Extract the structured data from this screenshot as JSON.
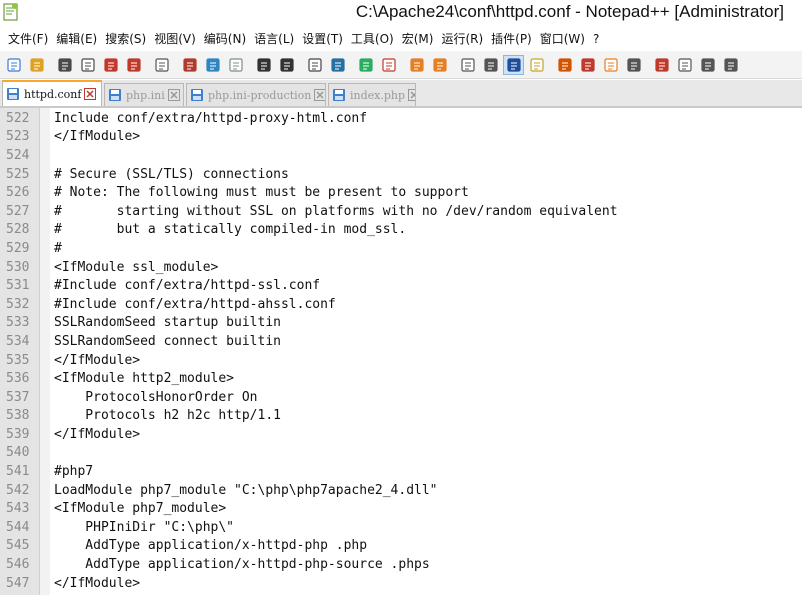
{
  "window": {
    "title": "C:\\Apache24\\conf\\httpd.conf - Notepad++ [Administrator]"
  },
  "menu": [
    {
      "label": "文件(F)"
    },
    {
      "label": "编辑(E)"
    },
    {
      "label": "搜索(S)"
    },
    {
      "label": "视图(V)"
    },
    {
      "label": "编码(N)"
    },
    {
      "label": "语言(L)"
    },
    {
      "label": "设置(T)"
    },
    {
      "label": "工具(O)"
    },
    {
      "label": "宏(M)"
    },
    {
      "label": "运行(R)"
    },
    {
      "label": "插件(P)"
    },
    {
      "label": "窗口(W)"
    },
    {
      "label": "?"
    }
  ],
  "toolbar": [
    {
      "icon": "new-file-icon"
    },
    {
      "icon": "open-file-icon"
    },
    {
      "icon": "save-icon"
    },
    {
      "icon": "save-all-icon"
    },
    {
      "icon": "close-file-icon"
    },
    {
      "icon": "close-all-icon"
    },
    {
      "icon": "print-icon"
    },
    {
      "icon": "cut-icon"
    },
    {
      "icon": "copy-icon"
    },
    {
      "icon": "paste-icon"
    },
    {
      "icon": "undo-icon"
    },
    {
      "icon": "redo-icon"
    },
    {
      "icon": "find-icon"
    },
    {
      "icon": "replace-icon"
    },
    {
      "icon": "zoom-in-icon"
    },
    {
      "icon": "zoom-out-icon"
    },
    {
      "icon": "sync-vertical-icon"
    },
    {
      "icon": "sync-horizontal-icon"
    },
    {
      "icon": "word-wrap-icon"
    },
    {
      "icon": "show-all-chars-icon"
    },
    {
      "icon": "indent-guide-icon"
    },
    {
      "icon": "user-language-icon"
    },
    {
      "icon": "doc-map-icon"
    },
    {
      "icon": "function-list-icon"
    },
    {
      "icon": "folder-workspace-icon"
    },
    {
      "icon": "monitoring-icon"
    },
    {
      "icon": "record-macro-icon"
    },
    {
      "icon": "stop-macro-icon"
    },
    {
      "icon": "play-macro-icon"
    },
    {
      "icon": "run-macro-multiple-icon"
    }
  ],
  "tabs": [
    {
      "label": "httpd.conf",
      "active": true
    },
    {
      "label": "php.ini",
      "active": false
    },
    {
      "label": "php.ini-production",
      "active": false
    },
    {
      "label": "index.php",
      "active": false
    }
  ],
  "lines": [
    {
      "n": "522",
      "text": "Include conf/extra/httpd-proxy-html.conf"
    },
    {
      "n": "523",
      "text": "</IfModule>"
    },
    {
      "n": "524",
      "text": ""
    },
    {
      "n": "525",
      "text": "# Secure (SSL/TLS) connections"
    },
    {
      "n": "526",
      "text": "# Note: The following must must be present to support"
    },
    {
      "n": "527",
      "text": "#       starting without SSL on platforms with no /dev/random equivalent"
    },
    {
      "n": "528",
      "text": "#       but a statically compiled-in mod_ssl."
    },
    {
      "n": "529",
      "text": "#"
    },
    {
      "n": "530",
      "text": "<IfModule ssl_module>"
    },
    {
      "n": "531",
      "text": "#Include conf/extra/httpd-ssl.conf"
    },
    {
      "n": "532",
      "text": "#Include conf/extra/httpd-ahssl.conf"
    },
    {
      "n": "533",
      "text": "SSLRandomSeed startup builtin"
    },
    {
      "n": "534",
      "text": "SSLRandomSeed connect builtin"
    },
    {
      "n": "535",
      "text": "</IfModule>"
    },
    {
      "n": "536",
      "text": "<IfModule http2_module>"
    },
    {
      "n": "537",
      "text": "    ProtocolsHonorOrder On"
    },
    {
      "n": "538",
      "text": "    Protocols h2 h2c http/1.1"
    },
    {
      "n": "539",
      "text": "</IfModule>"
    },
    {
      "n": "540",
      "text": ""
    },
    {
      "n": "541",
      "text": "#php7"
    },
    {
      "n": "542",
      "text": "LoadModule php7_module \"C:\\php\\php7apache2_4.dll\""
    },
    {
      "n": "543",
      "text": "<IfModule php7_module>"
    },
    {
      "n": "544",
      "text": "    PHPIniDir \"C:\\php\\\""
    },
    {
      "n": "545",
      "text": "    AddType application/x-httpd-php .php"
    },
    {
      "n": "546",
      "text": "    AddType application/x-httpd-php-source .phps"
    },
    {
      "n": "547",
      "text": "</IfModule>"
    }
  ]
}
